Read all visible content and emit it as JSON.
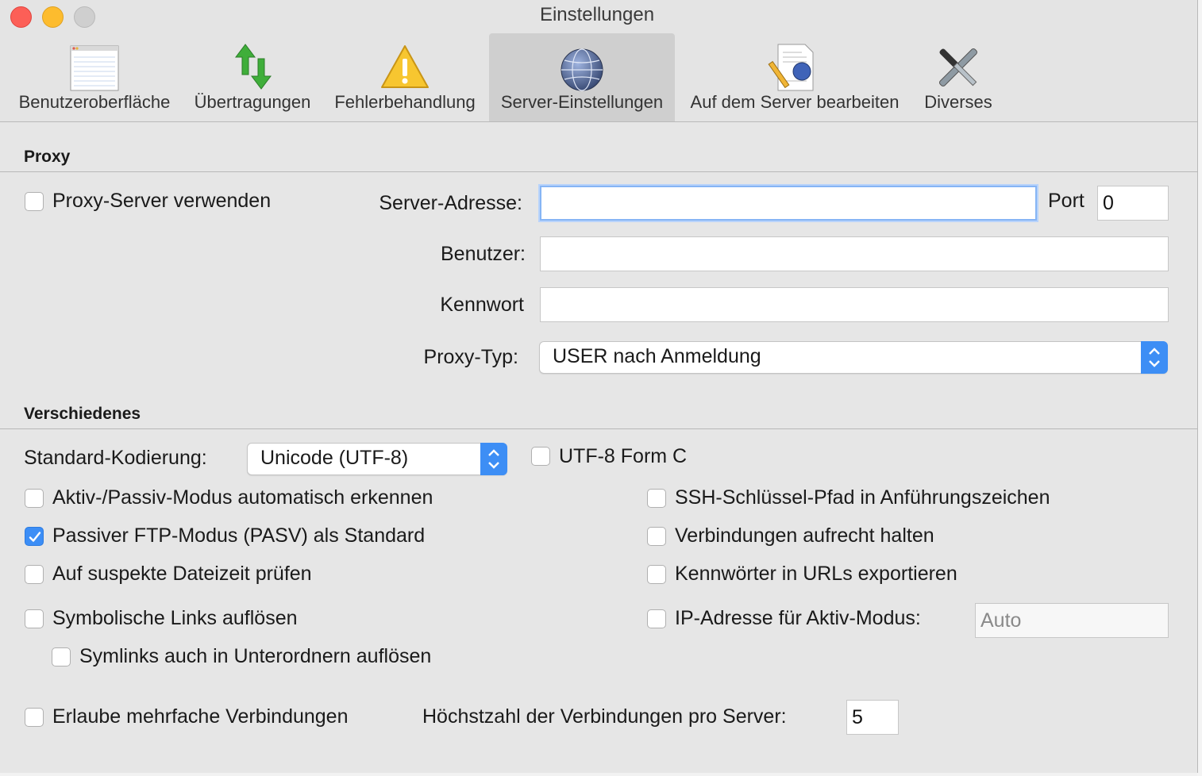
{
  "window": {
    "title": "Einstellungen"
  },
  "toolbar": {
    "items": [
      {
        "label": "Benutzeroberfläche",
        "icon": "window-icon"
      },
      {
        "label": "Übertragungen",
        "icon": "transfer-arrows-icon"
      },
      {
        "label": "Fehlerbehandlung",
        "icon": "warning-icon"
      },
      {
        "label": "Server-Einstellungen",
        "icon": "globe-icon",
        "selected": true
      },
      {
        "label": "Auf dem Server bearbeiten",
        "icon": "edit-document-icon"
      },
      {
        "label": "Diverses",
        "icon": "tools-icon"
      }
    ]
  },
  "proxy": {
    "section_title": "Proxy",
    "use_proxy_label": "Proxy-Server verwenden",
    "use_proxy_checked": false,
    "server_address_label": "Server-Adresse:",
    "server_address_value": "",
    "port_label": "Port",
    "port_value": "0",
    "user_label": "Benutzer:",
    "user_value": "",
    "password_label": "Kennwort",
    "password_value": "",
    "proxy_type_label": "Proxy-Typ:",
    "proxy_type_value": "USER nach Anmeldung"
  },
  "misc": {
    "section_title": "Verschiedenes",
    "encoding_label": "Standard-Kodierung:",
    "encoding_value": "Unicode (UTF-8)",
    "utf8_form_c_label": "UTF-8 Form C",
    "auto_detect_mode_label": "Aktiv-/Passiv-Modus automatisch erkennen",
    "ssh_key_quotes_label": "SSH-Schlüssel-Pfad in Anführungszeichen",
    "passive_ftp_label": "Passiver FTP-Modus (PASV) als Standard",
    "passive_ftp_checked": true,
    "keep_alive_label": "Verbindungen aufrecht halten",
    "suspicious_time_label": "Auf suspekte Dateizeit prüfen",
    "export_passwords_label": "Kennwörter in URLs exportieren",
    "resolve_symlinks_label": "Symbolische Links auflösen",
    "ip_active_label": "IP-Adresse für Aktiv-Modus:",
    "ip_active_value": "Auto",
    "resolve_symlinks_sub_label": "Symlinks auch in Unterordnern auflösen",
    "multiple_connections_label": "Erlaube mehrfache Verbindungen",
    "max_connections_label": "Höchstzahl der Verbindungen pro Server:",
    "max_connections_value": "5"
  },
  "colors": {
    "accent": "#3c8ef6",
    "window_bg": "#e6e6e6",
    "close": "#fc5f57",
    "minimize": "#fdbc2e",
    "zoom": "#cfcfcf"
  }
}
